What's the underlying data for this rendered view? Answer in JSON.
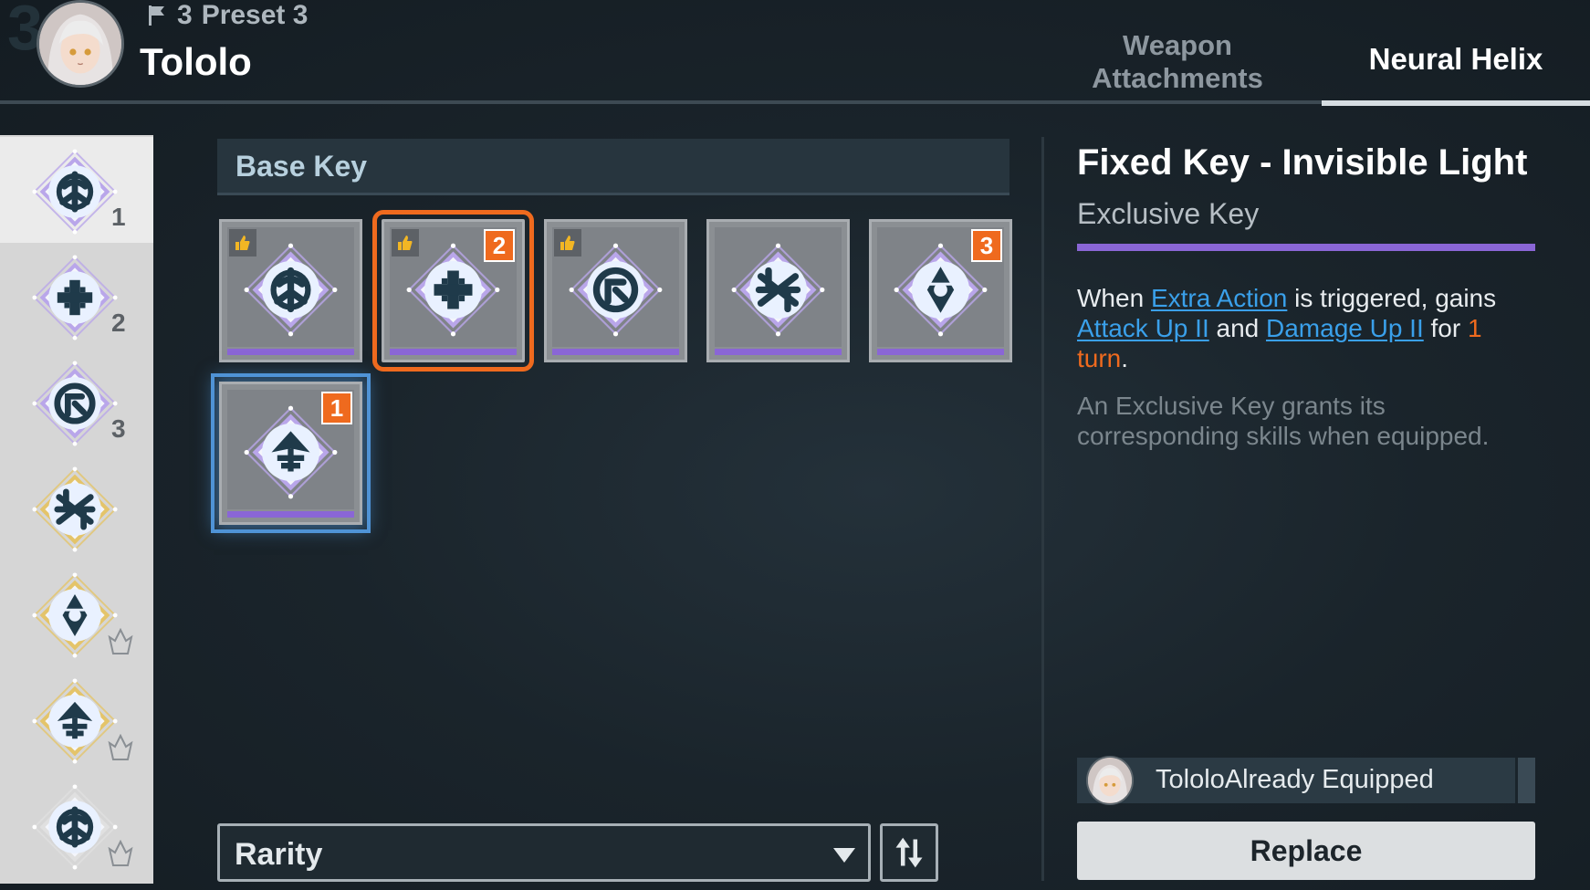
{
  "header": {
    "bg_mark": "3",
    "preset_number": "3",
    "preset_label": "Preset 3",
    "character_name": "Tololo",
    "tabs": [
      {
        "label": "Weapon Attachments",
        "active": false
      },
      {
        "label": "Neural Helix",
        "active": true
      }
    ]
  },
  "sidebar": {
    "items": [
      {
        "slot": "1",
        "icon": "helix-key-slot-icon",
        "active": true,
        "frame_color": "#b9a6ea"
      },
      {
        "slot": "2",
        "icon": "helix-key-slot-icon",
        "active": false,
        "frame_color": "#b9a6ea"
      },
      {
        "slot": "3",
        "icon": "helix-key-slot-icon",
        "active": false,
        "frame_color": "#b9a6ea"
      },
      {
        "slot": "",
        "icon": "helix-key-slot-icon",
        "active": false,
        "frame_color": "#e4c46a"
      },
      {
        "slot": "",
        "icon": "lock-icon",
        "active": false,
        "frame_color": "#e4c46a",
        "locked": true
      },
      {
        "slot": "",
        "icon": "lock-icon",
        "active": false,
        "frame_color": "#e4c46a",
        "locked": true
      },
      {
        "slot": "",
        "icon": "lock-icon",
        "active": false,
        "frame_color": "#e0e0e0",
        "locked": true
      }
    ]
  },
  "base_key": {
    "title": "Base Key",
    "keys": [
      {
        "recommended": true,
        "badge": ""
      },
      {
        "recommended": true,
        "badge": "2",
        "selected": "orange"
      },
      {
        "recommended": true,
        "badge": ""
      },
      {
        "recommended": false,
        "badge": ""
      },
      {
        "recommended": false,
        "badge": "3"
      },
      {
        "recommended": false,
        "badge": "1",
        "selected": "blue"
      }
    ]
  },
  "controls": {
    "sort_label": "Rarity"
  },
  "detail": {
    "title": "Fixed Key - Invisible Light",
    "subtitle": "Exclusive Key",
    "desc_when": "When ",
    "desc_kw1": "Extra Action",
    "desc_mid1": " is triggered, gains ",
    "desc_kw2": "Attack Up II",
    "desc_and": " and ",
    "desc_kw3": "Damage Up II",
    "desc_for": " for ",
    "desc_num": "1",
    "desc_turn": "turn",
    "desc_end": ".",
    "note": "An Exclusive Key grants its corresponding skills when equipped.",
    "equipped_text": "TololoAlready Equipped",
    "replace_label": "Replace"
  },
  "colors": {
    "accent_orange": "#ef6a1e",
    "rarity_purple": "#8a66d6",
    "keyword_blue": "#3aa0ea"
  }
}
